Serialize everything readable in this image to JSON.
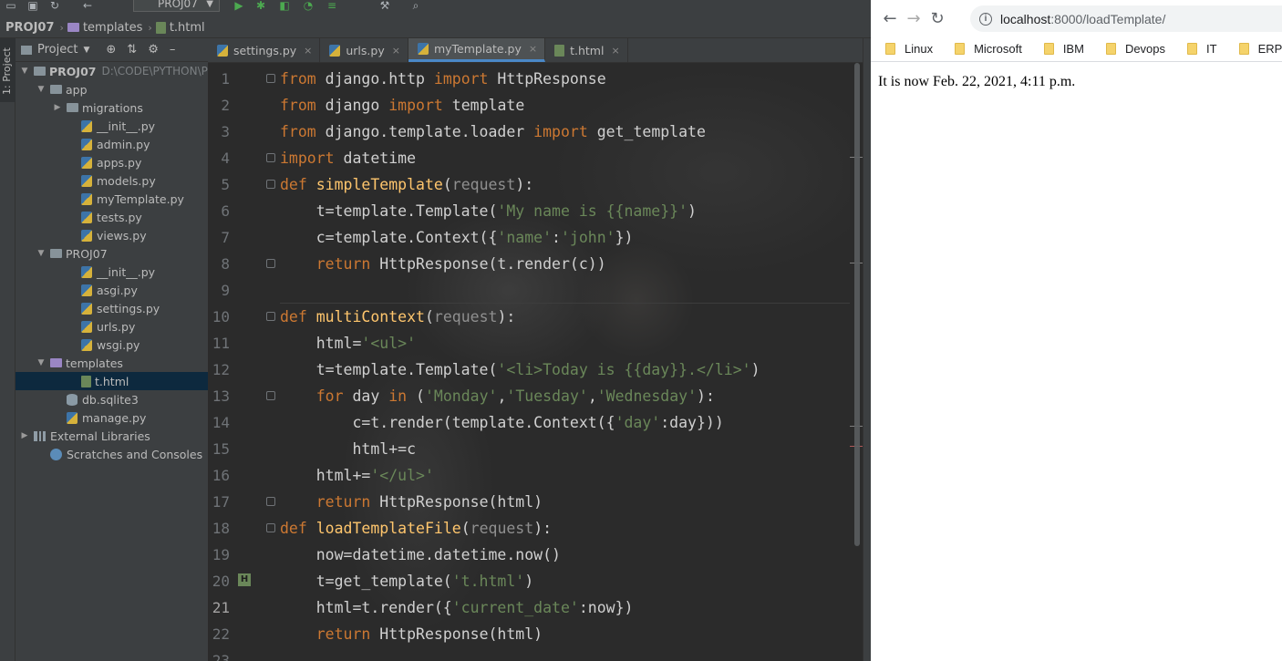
{
  "ide": {
    "project_combo": "PROJ07",
    "breadcrumb": [
      "PROJ07",
      "templates",
      "t.html"
    ],
    "left_strip_label": "1: Project",
    "project_panel": {
      "title": "Project",
      "tree": [
        {
          "label": "PROJ07",
          "extra": "D:\\CODE\\PYTHON\\P",
          "depth": 0,
          "kind": "folder",
          "arrow": "▼",
          "bold": true
        },
        {
          "label": "app",
          "depth": 1,
          "kind": "folder",
          "arrow": "▼"
        },
        {
          "label": "migrations",
          "depth": 2,
          "kind": "folder",
          "arrow": "▶"
        },
        {
          "label": "__init__.py",
          "depth": 3,
          "kind": "py"
        },
        {
          "label": "admin.py",
          "depth": 3,
          "kind": "py"
        },
        {
          "label": "apps.py",
          "depth": 3,
          "kind": "py"
        },
        {
          "label": "models.py",
          "depth": 3,
          "kind": "py"
        },
        {
          "label": "myTemplate.py",
          "depth": 3,
          "kind": "py"
        },
        {
          "label": "tests.py",
          "depth": 3,
          "kind": "py"
        },
        {
          "label": "views.py",
          "depth": 3,
          "kind": "py"
        },
        {
          "label": "PROJ07",
          "depth": 1,
          "kind": "folder",
          "arrow": "▼"
        },
        {
          "label": "__init__.py",
          "depth": 3,
          "kind": "py"
        },
        {
          "label": "asgi.py",
          "depth": 3,
          "kind": "py"
        },
        {
          "label": "settings.py",
          "depth": 3,
          "kind": "py"
        },
        {
          "label": "urls.py",
          "depth": 3,
          "kind": "py"
        },
        {
          "label": "wsgi.py",
          "depth": 3,
          "kind": "py"
        },
        {
          "label": "templates",
          "depth": 1,
          "kind": "folder-purple",
          "arrow": "▼"
        },
        {
          "label": "t.html",
          "depth": 3,
          "kind": "html",
          "selected": true
        },
        {
          "label": "db.sqlite3",
          "depth": 2,
          "kind": "db"
        },
        {
          "label": "manage.py",
          "depth": 2,
          "kind": "py"
        },
        {
          "label": "External Libraries",
          "depth": 0,
          "kind": "lib",
          "arrow": "▶"
        },
        {
          "label": "Scratches and Consoles",
          "depth": 1,
          "kind": "scratch"
        }
      ]
    },
    "editor_tabs": [
      {
        "label": "settings.py",
        "icon": "py",
        "active": false
      },
      {
        "label": "urls.py",
        "icon": "py",
        "active": false
      },
      {
        "label": "myTemplate.py",
        "icon": "py",
        "active": true
      },
      {
        "label": "t.html",
        "icon": "html",
        "active": false
      }
    ],
    "current_line": 21,
    "code_lines": [
      [
        [
          "kw",
          "from"
        ],
        [
          "t",
          " django.http "
        ],
        [
          "kw",
          "import"
        ],
        [
          "t",
          " HttpResponse"
        ]
      ],
      [
        [
          "kw",
          "from"
        ],
        [
          "t",
          " django "
        ],
        [
          "kw",
          "import"
        ],
        [
          "t",
          " template"
        ]
      ],
      [
        [
          "kw",
          "from"
        ],
        [
          "t",
          " django.template.loader "
        ],
        [
          "kw",
          "import"
        ],
        [
          "t",
          " get_template"
        ]
      ],
      [
        [
          "kw",
          "import"
        ],
        [
          "t",
          " datetime"
        ]
      ],
      [
        [
          "kw",
          "def"
        ],
        [
          "t",
          " "
        ],
        [
          "fn",
          "simpleTemplate"
        ],
        [
          "t",
          "("
        ],
        [
          "param",
          "request"
        ],
        [
          "t",
          "):"
        ]
      ],
      [
        [
          "t",
          "    t=template.Template("
        ],
        [
          "str",
          "'My name is {{name}}'"
        ],
        [
          "t",
          ")"
        ]
      ],
      [
        [
          "t",
          "    c=template.Context({"
        ],
        [
          "str",
          "'name'"
        ],
        [
          "t",
          ":"
        ],
        [
          "str",
          "'john'"
        ],
        [
          "t",
          "})"
        ]
      ],
      [
        [
          "t",
          "    "
        ],
        [
          "kw",
          "return"
        ],
        [
          "t",
          " HttpResponse(t.render(c))"
        ]
      ],
      [
        [
          "t",
          ""
        ]
      ],
      [
        [
          "kw",
          "def"
        ],
        [
          "t",
          " "
        ],
        [
          "fn",
          "multiContext"
        ],
        [
          "t",
          "("
        ],
        [
          "param",
          "request"
        ],
        [
          "t",
          "):"
        ]
      ],
      [
        [
          "t",
          "    html="
        ],
        [
          "str",
          "'<ul>'"
        ]
      ],
      [
        [
          "t",
          "    t=template.Template("
        ],
        [
          "str",
          "'<li>Today is {{day}}.</li>'"
        ],
        [
          "t",
          ")"
        ]
      ],
      [
        [
          "t",
          "    "
        ],
        [
          "kw",
          "for"
        ],
        [
          "t",
          " day "
        ],
        [
          "kw",
          "in"
        ],
        [
          "t",
          " ("
        ],
        [
          "str",
          "'Monday'"
        ],
        [
          "t",
          ","
        ],
        [
          "str",
          "'Tuesday'"
        ],
        [
          "t",
          ","
        ],
        [
          "str",
          "'Wednesday'"
        ],
        [
          "t",
          "):"
        ]
      ],
      [
        [
          "t",
          "        c=t.render(template.Context({"
        ],
        [
          "str",
          "'day'"
        ],
        [
          "t",
          ":day}))"
        ]
      ],
      [
        [
          "t",
          "        html+=c"
        ]
      ],
      [
        [
          "t",
          "    html+="
        ],
        [
          "str",
          "'</ul>'"
        ]
      ],
      [
        [
          "t",
          "    "
        ],
        [
          "kw",
          "return"
        ],
        [
          "t",
          " HttpResponse(html)"
        ]
      ],
      [
        [
          "kw",
          "def"
        ],
        [
          "t",
          " "
        ],
        [
          "fn",
          "loadTemplateFile"
        ],
        [
          "t",
          "("
        ],
        [
          "param",
          "request"
        ],
        [
          "t",
          "):"
        ]
      ],
      [
        [
          "t",
          "    now=datetime.datetime.now()"
        ]
      ],
      [
        [
          "t",
          "    t=get_template("
        ],
        [
          "str",
          "'t.html'"
        ],
        [
          "t",
          ")"
        ]
      ],
      [
        [
          "t",
          "    html=t.render({"
        ],
        [
          "str",
          "'current_date'"
        ],
        [
          "t",
          ":now})"
        ]
      ],
      [
        [
          "t",
          "    "
        ],
        [
          "kw",
          "return"
        ],
        [
          "t",
          " HttpResponse(html)"
        ]
      ],
      [
        [
          "t",
          ""
        ]
      ]
    ],
    "icons": [
      "folder-icon",
      "python-file-icon",
      "html-file-icon",
      "run-icon",
      "debug-icon",
      "settings-icon",
      "search-icon"
    ]
  },
  "browser": {
    "url_host": "localhost",
    "url_path": ":8000/loadTemplate/",
    "bookmarks": [
      "Linux",
      "Microsoft",
      "IBM",
      "Devops",
      "IT",
      "ERP"
    ],
    "page_text": "It is now Feb. 22, 2021, 4:11 p.m."
  },
  "colors": {
    "keyword": "#cc7832",
    "function": "#ffc66d",
    "string": "#6a8759",
    "editor_bg": "#2b2b2b",
    "panel_bg": "#3c3f41"
  }
}
